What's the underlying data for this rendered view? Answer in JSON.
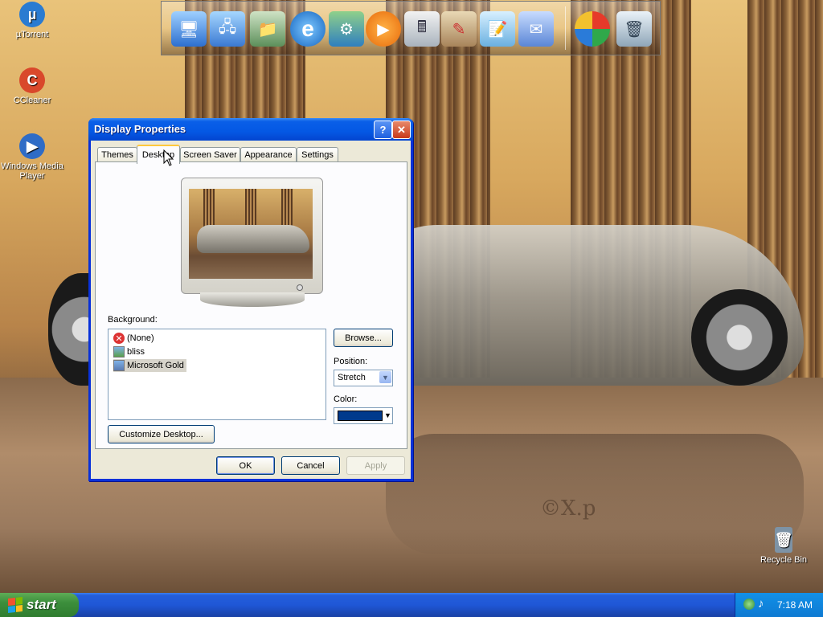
{
  "desktop": {
    "icons": [
      {
        "label": "µTorrent",
        "icon": "utorrent-icon",
        "color": "#2a7bd1"
      },
      {
        "label": "CCleaner",
        "icon": "ccleaner-icon",
        "color": "#d9482b"
      },
      {
        "label": "Windows Media Player",
        "icon": "media-player-icon",
        "color": "#2f6cc6"
      },
      {
        "label": "Recycle Bin",
        "icon": "recycle-bin-icon",
        "color": "#7d93a6"
      }
    ],
    "watermark": "©X.p"
  },
  "dock": {
    "items": [
      {
        "icon": "my-computer-icon",
        "glyph": "🖥"
      },
      {
        "icon": "network-icon",
        "glyph": "🖧"
      },
      {
        "icon": "documents-icon",
        "glyph": "📁"
      },
      {
        "icon": "internet-explorer-icon",
        "glyph": "e"
      },
      {
        "icon": "control-panel-icon",
        "glyph": "⚙"
      },
      {
        "icon": "media-player-icon",
        "glyph": "▶"
      },
      {
        "icon": "calculator-icon",
        "glyph": "🖩"
      },
      {
        "icon": "paint-icon",
        "glyph": "✎"
      },
      {
        "icon": "notepad-icon",
        "glyph": "📝"
      },
      {
        "icon": "email-icon",
        "glyph": "✉"
      },
      {
        "icon": "windows-start-orb-icon",
        "glyph": "⊞"
      },
      {
        "icon": "recycle-bin-icon",
        "glyph": "🗑"
      }
    ]
  },
  "window": {
    "title": "Display Properties",
    "help": "?",
    "close": "✕",
    "tabs": [
      "Themes",
      "Desktop",
      "Screen Saver",
      "Appearance",
      "Settings"
    ],
    "active_tab": "Desktop",
    "background_label": "Background:",
    "background_items": [
      {
        "label": "(None)",
        "icon": "none-icon"
      },
      {
        "label": "bliss",
        "icon": "image-file-icon"
      },
      {
        "label": "Microsoft Gold",
        "icon": "image-file-icon"
      }
    ],
    "selected_background": "Microsoft Gold",
    "browse": "Browse...",
    "position_label": "Position:",
    "position_value": "Stretch",
    "color_label": "Color:",
    "color_value": "#003a8c",
    "customize": "Customize Desktop...",
    "ok": "OK",
    "cancel": "Cancel",
    "apply": "Apply"
  },
  "taskbar": {
    "start_label": "start",
    "clock": "7:18 AM"
  }
}
